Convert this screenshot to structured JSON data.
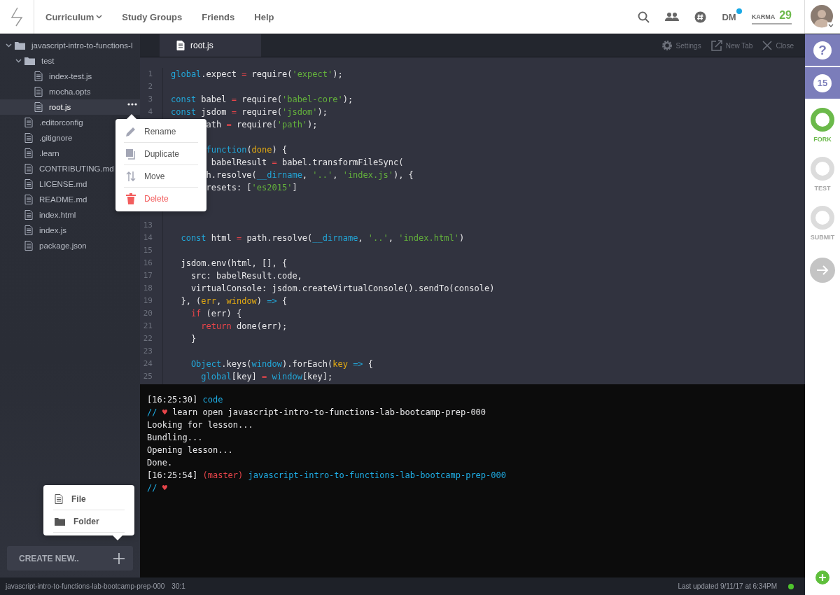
{
  "header": {
    "nav": [
      {
        "label": "Curriculum",
        "dropdown": true
      },
      {
        "label": "Study Groups",
        "dropdown": false
      },
      {
        "label": "Friends",
        "dropdown": false
      },
      {
        "label": "Help",
        "dropdown": false
      }
    ],
    "dm": {
      "label": "DM",
      "unread": true
    },
    "karma": {
      "label": "KARMA",
      "value": "29"
    }
  },
  "file_tree": [
    {
      "name": "javascript-intro-to-functions-l",
      "kind": "folder",
      "expanded": true,
      "selected": false,
      "children": [
        {
          "name": "test",
          "kind": "folder",
          "expanded": true,
          "selected": false,
          "children": [
            {
              "name": "index-test.js",
              "kind": "file",
              "selected": false
            },
            {
              "name": "mocha.opts",
              "kind": "file",
              "selected": false
            },
            {
              "name": "root.js",
              "kind": "file",
              "selected": true
            }
          ]
        },
        {
          "name": ".editorconfig",
          "kind": "file",
          "selected": false
        },
        {
          "name": ".gitignore",
          "kind": "file",
          "selected": false
        },
        {
          "name": ".learn",
          "kind": "file",
          "selected": false
        },
        {
          "name": "CONTRIBUTING.md",
          "kind": "file",
          "selected": false
        },
        {
          "name": "LICENSE.md",
          "kind": "file",
          "selected": false
        },
        {
          "name": "README.md",
          "kind": "file",
          "selected": false
        },
        {
          "name": "index.html",
          "kind": "file",
          "selected": false
        },
        {
          "name": "index.js",
          "kind": "file",
          "selected": false
        },
        {
          "name": "package.json",
          "kind": "file",
          "selected": false
        }
      ]
    }
  ],
  "context_menu": [
    {
      "label": "Rename",
      "kind": "rename"
    },
    {
      "label": "Duplicate",
      "kind": "duplicate"
    },
    {
      "label": "Move",
      "kind": "move"
    },
    {
      "label": "Delete",
      "kind": "delete"
    }
  ],
  "create_new": {
    "label": "CREATE NEW..",
    "menu": [
      {
        "label": "File",
        "kind": "file"
      },
      {
        "label": "Folder",
        "kind": "folder"
      }
    ]
  },
  "editor": {
    "tabs": [
      {
        "label": "root.js",
        "selected": true
      }
    ],
    "tools": [
      {
        "label": "Settings",
        "kind": "settings"
      },
      {
        "label": "New Tab",
        "kind": "new-tab"
      },
      {
        "label": "Close",
        "kind": "close"
      }
    ],
    "lines": [
      {
        "kind": "code",
        "number": "1",
        "tokens": [
          {
            "text": "global",
            "kind": "keyword"
          },
          {
            "text": ".expect ",
            "kind": "plain"
          },
          {
            "text": "=",
            "kind": "operator"
          },
          {
            "text": " require(",
            "kind": "plain"
          },
          {
            "text": "'expect'",
            "kind": "string"
          },
          {
            "text": ");",
            "kind": "plain"
          }
        ]
      },
      {
        "kind": "code",
        "number": "2"
      },
      {
        "kind": "code",
        "number": "3",
        "tokens": [
          {
            "text": "const",
            "kind": "keyword"
          },
          {
            "text": " babel ",
            "kind": "plain"
          },
          {
            "text": "=",
            "kind": "operator"
          },
          {
            "text": " require(",
            "kind": "plain"
          },
          {
            "text": "'babel-core'",
            "kind": "string"
          },
          {
            "text": ");",
            "kind": "plain"
          }
        ]
      },
      {
        "kind": "code",
        "number": "4",
        "tokens": [
          {
            "text": "const",
            "kind": "keyword"
          },
          {
            "text": " jsdom ",
            "kind": "plain"
          },
          {
            "text": "=",
            "kind": "operator"
          },
          {
            "text": " require(",
            "kind": "plain"
          },
          {
            "text": "'jsdom'",
            "kind": "string"
          },
          {
            "text": ");",
            "kind": "plain"
          }
        ]
      },
      {
        "kind": "code",
        "tokens": [
          {
            "text": "       ath ",
            "kind": "plain"
          },
          {
            "text": "=",
            "kind": "operator"
          },
          {
            "text": " require(",
            "kind": "plain"
          },
          {
            "text": "'path'",
            "kind": "string"
          },
          {
            "text": ");",
            "kind": "plain"
          }
        ]
      },
      {
        "kind": "blank"
      },
      {
        "kind": "code",
        "tokens": [
          {
            "text": "       function",
            "kind": "keyword"
          },
          {
            "text": "(",
            "kind": "plain"
          },
          {
            "text": "done",
            "kind": "param"
          },
          {
            "text": ") {",
            "kind": "plain"
          }
        ]
      },
      {
        "kind": "code",
        "tokens": [
          {
            "text": "        babelResult ",
            "kind": "plain"
          },
          {
            "text": "=",
            "kind": "operator"
          },
          {
            "text": " babel.transformFileSync(",
            "kind": "plain"
          }
        ]
      },
      {
        "kind": "code",
        "tokens": [
          {
            "text": "       h.resolve(",
            "kind": "plain"
          },
          {
            "text": "__dirname",
            "kind": "keyword"
          },
          {
            "text": ", ",
            "kind": "plain"
          },
          {
            "text": "'..'",
            "kind": "string"
          },
          {
            "text": ", ",
            "kind": "plain"
          },
          {
            "text": "'index.js'",
            "kind": "string"
          },
          {
            "text": "), {",
            "kind": "plain"
          }
        ]
      },
      {
        "kind": "code",
        "tokens": [
          {
            "text": "       resets: [",
            "kind": "plain"
          },
          {
            "text": "'es2015'",
            "kind": "string"
          },
          {
            "text": "]",
            "kind": "plain"
          }
        ]
      },
      {
        "kind": "blank"
      },
      {
        "kind": "blank"
      },
      {
        "kind": "code",
        "number": "13"
      },
      {
        "kind": "code",
        "number": "14",
        "tokens": [
          {
            "text": "  const",
            "kind": "keyword"
          },
          {
            "text": " html ",
            "kind": "plain"
          },
          {
            "text": "=",
            "kind": "operator"
          },
          {
            "text": " path.resolve(",
            "kind": "plain"
          },
          {
            "text": "__dirname",
            "kind": "keyword"
          },
          {
            "text": ", ",
            "kind": "plain"
          },
          {
            "text": "'..'",
            "kind": "string"
          },
          {
            "text": ", ",
            "kind": "plain"
          },
          {
            "text": "'index.html'",
            "kind": "string"
          },
          {
            "text": ")",
            "kind": "plain"
          }
        ]
      },
      {
        "kind": "code",
        "number": "15"
      },
      {
        "kind": "code",
        "number": "16",
        "tokens": [
          {
            "text": "  jsdom.env(html, [], {",
            "kind": "plain"
          }
        ]
      },
      {
        "kind": "code",
        "number": "17",
        "tokens": [
          {
            "text": "    src: babelResult.code,",
            "kind": "plain"
          }
        ]
      },
      {
        "kind": "code",
        "number": "18",
        "tokens": [
          {
            "text": "    virtualConsole: jsdom.createVirtualConsole().sendTo(console)",
            "kind": "plain"
          }
        ]
      },
      {
        "kind": "code",
        "number": "19",
        "tokens": [
          {
            "text": "  }, (",
            "kind": "plain"
          },
          {
            "text": "err",
            "kind": "param"
          },
          {
            "text": ", ",
            "kind": "plain"
          },
          {
            "text": "window",
            "kind": "param"
          },
          {
            "text": ") ",
            "kind": "plain"
          },
          {
            "text": "=>",
            "kind": "keyword"
          },
          {
            "text": " {",
            "kind": "plain"
          }
        ]
      },
      {
        "kind": "code",
        "number": "20",
        "tokens": [
          {
            "text": "    if",
            "kind": "control"
          },
          {
            "text": " (err) {",
            "kind": "plain"
          }
        ]
      },
      {
        "kind": "code",
        "number": "21",
        "tokens": [
          {
            "text": "      return",
            "kind": "control"
          },
          {
            "text": " done(err);",
            "kind": "plain"
          }
        ]
      },
      {
        "kind": "code",
        "number": "22",
        "tokens": [
          {
            "text": "    }",
            "kind": "plain"
          }
        ]
      },
      {
        "kind": "code",
        "number": "23"
      },
      {
        "kind": "code",
        "number": "24",
        "tokens": [
          {
            "text": "    Object",
            "kind": "keyword"
          },
          {
            "text": ".keys(",
            "kind": "plain"
          },
          {
            "text": "window",
            "kind": "keyword"
          },
          {
            "text": ").forEach(",
            "kind": "plain"
          },
          {
            "text": "key",
            "kind": "param"
          },
          {
            "text": " =>",
            "kind": "keyword"
          },
          {
            "text": " {",
            "kind": "plain"
          }
        ]
      },
      {
        "kind": "code",
        "number": "25",
        "tokens": [
          {
            "text": "      global",
            "kind": "keyword"
          },
          {
            "text": "[key] ",
            "kind": "plain"
          },
          {
            "text": "=",
            "kind": "operator"
          },
          {
            "text": " window",
            "kind": "keyword"
          },
          {
            "text": "[key];",
            "kind": "plain"
          }
        ]
      }
    ]
  },
  "terminal": [
    [
      {
        "text": "[16:25:30] ",
        "kind": "plain"
      },
      {
        "text": "code",
        "kind": "info"
      }
    ],
    [
      {
        "text": "// ",
        "kind": "info"
      },
      {
        "text": "♥",
        "kind": "alert"
      },
      {
        "text": " learn open javascript-intro-to-functions-lab-bootcamp-prep-000",
        "kind": "plain"
      }
    ],
    [
      {
        "text": "Looking for lesson...",
        "kind": "plain"
      }
    ],
    [
      {
        "text": "Bundling...",
        "kind": "plain"
      }
    ],
    [
      {
        "text": "Opening lesson...",
        "kind": "plain"
      }
    ],
    [
      {
        "text": "Done.",
        "kind": "plain"
      }
    ],
    [
      {
        "text": "[16:25:54] ",
        "kind": "plain"
      },
      {
        "text": "(master)",
        "kind": "alert"
      },
      {
        "text": " javascript-intro-to-functions-lab-bootcamp-prep-000",
        "kind": "info"
      }
    ],
    [
      {
        "text": "// ",
        "kind": "info"
      },
      {
        "text": "♥",
        "kind": "alert"
      }
    ]
  ],
  "rail": {
    "help": "?",
    "badge": "15",
    "steps": [
      {
        "label": "FORK",
        "done": true
      },
      {
        "label": "TEST",
        "done": false
      },
      {
        "label": "SUBMIT",
        "done": false
      }
    ]
  },
  "status_bar": {
    "path": "javascript-intro-to-functions-lab-bootcamp-prep-000",
    "cursor": "30:1",
    "updated": "Last updated 9/11/17 at 6:34PM",
    "connected": true
  }
}
